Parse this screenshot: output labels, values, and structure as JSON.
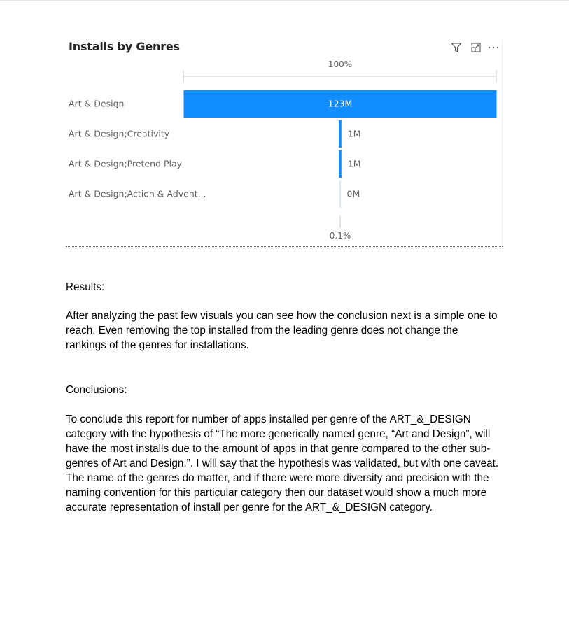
{
  "chart_data": {
    "type": "bar",
    "title": "Installs by Genres",
    "categories": [
      "Art & Design",
      "Art & Design;Creativity",
      "Art & Design;Pretend Play",
      "Art & Design;Action & Advent..."
    ],
    "values": [
      123,
      1,
      1,
      0
    ],
    "data_labels": [
      "123M",
      "1M",
      "1M",
      "0M"
    ],
    "unit": "M",
    "axis_top_label": "100%",
    "axis_bottom_label": "0.1%",
    "bar_color": "#118DFF",
    "axis_color": "#c8c8c8"
  },
  "results": {
    "heading": "Results:",
    "body": "After analyzing the past few visuals you can see how the conclusion next is a simple one to reach. Even removing the top installed from the leading genre does not change the rankings of the genres for installations."
  },
  "conclusions": {
    "heading": "Conclusions:",
    "body": "To conclude this report for number of apps installed per genre of the ART_&_DESIGN category with the hypothesis of “The more generically named genre, “Art and Design”, will have the most installs due to the amount of apps in that genre compared to the other sub-genres of Art and Design.”. I will say that the hypothesis was validated, but with one caveat. The name of the genres do matter, and if there were more diversity and precision with the naming convention for this particular category then our dataset would show a much more accurate representation of install per genre for the ART_&_DESIGN category."
  },
  "icons": [
    "filter-icon",
    "focus-mode-icon",
    "more-options-icon"
  ]
}
